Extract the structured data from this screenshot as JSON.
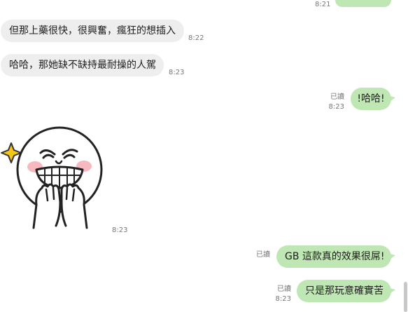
{
  "messages": [
    {
      "text": "",
      "time": "8:21"
    },
    {
      "text": "但那上藥很快，很興奮，瘋狂的想插入",
      "time": "8:22"
    },
    {
      "text": "哈哈，那她缺不缺持最耐操的人駕",
      "time": "8:23"
    },
    {
      "text": "!哈哈!",
      "read": "已讀",
      "time": "8:23"
    },
    {
      "sticker": "grinning-face-sticker",
      "time": "8:23"
    },
    {
      "text": "GB 這款真的效果很屌!",
      "read": "已讀",
      "time": ""
    },
    {
      "text": "只是那玩意確實苦",
      "read": "已讀",
      "time": "8:23"
    }
  ],
  "colors": {
    "incoming_bubble": "#eeeeee",
    "outgoing_bubble": "#bfe7b3",
    "meta_text": "#777777",
    "sparkle": "#f5c518",
    "blush": "#f7b9c0"
  }
}
